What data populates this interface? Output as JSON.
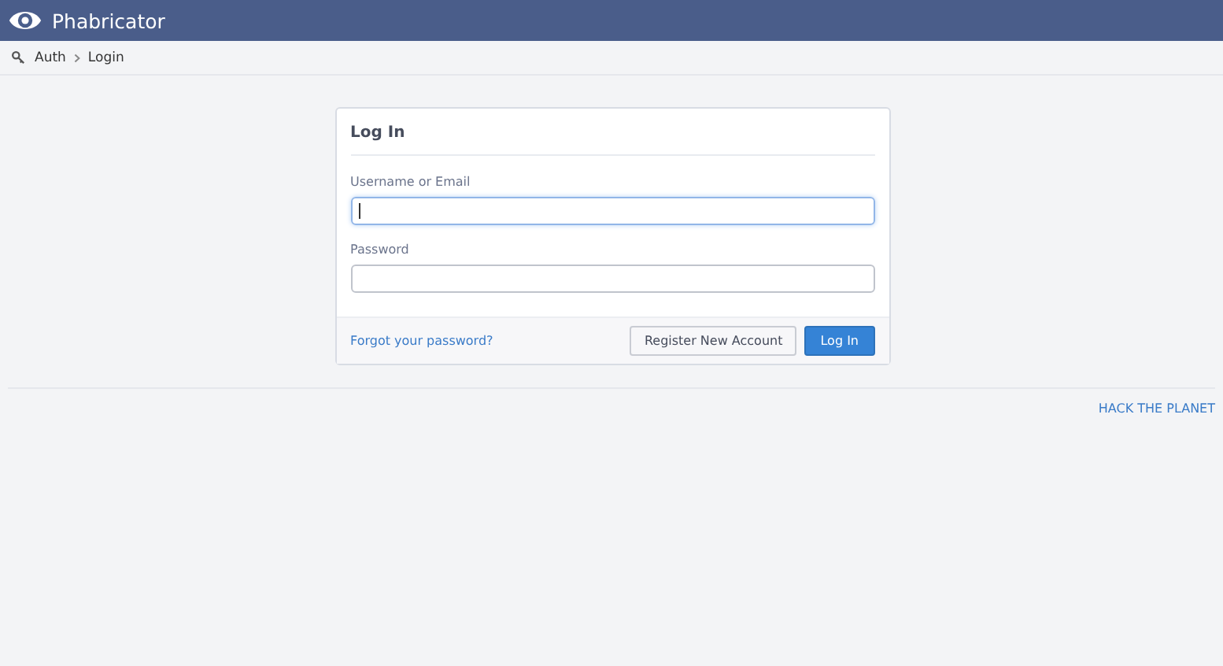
{
  "header": {
    "title": "Phabricator"
  },
  "breadcrumbs": [
    {
      "label": "Auth",
      "kind": "app"
    },
    {
      "label": "Login",
      "kind": "page"
    }
  ],
  "login": {
    "title": "Log In",
    "fields": [
      {
        "label": "Username or Email",
        "focused": true
      },
      {
        "label": "Password",
        "focused": false
      }
    ],
    "forgot_link": "Forgot your password?",
    "buttons": [
      {
        "label": "Register New Account",
        "kind": "secondary"
      },
      {
        "label": "Log In",
        "kind": "primary"
      }
    ]
  },
  "footer": {
    "link": "HACK THE PLANET"
  }
}
